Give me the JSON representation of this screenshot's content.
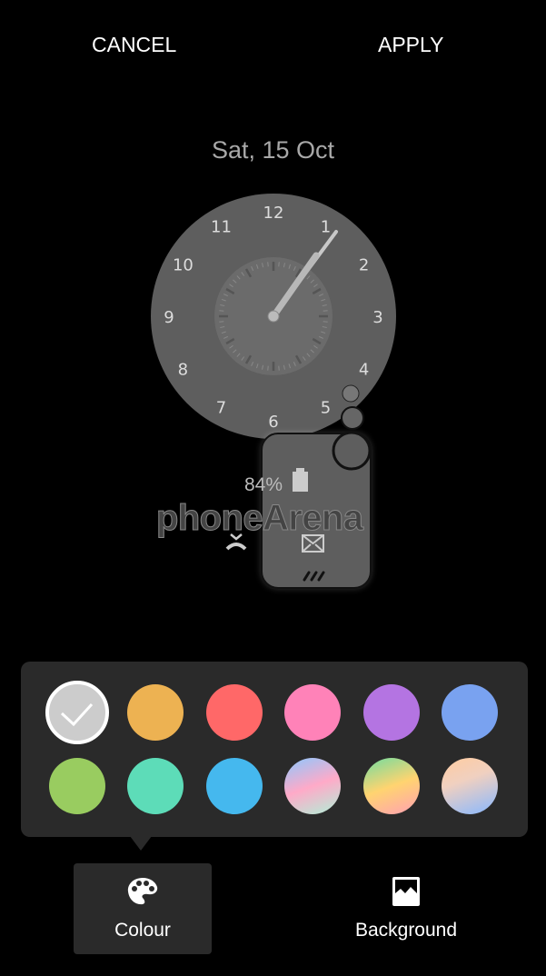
{
  "header": {
    "cancel_label": "CANCEL",
    "apply_label": "APPLY"
  },
  "preview": {
    "date": "Sat, 15 Oct",
    "clock_numbers": [
      "12",
      "1",
      "2",
      "3",
      "4",
      "5",
      "6",
      "7",
      "8",
      "9",
      "10",
      "11"
    ],
    "battery_percent": "84%",
    "watermark": "phoneArena"
  },
  "palette": {
    "swatches": [
      {
        "name": "grey",
        "color": "#cccccc",
        "selected": true
      },
      {
        "name": "orange",
        "color": "#edb252"
      },
      {
        "name": "red",
        "color": "#ff6868"
      },
      {
        "name": "pink",
        "color": "#ff82b8"
      },
      {
        "name": "purple",
        "color": "#b474e2"
      },
      {
        "name": "blue",
        "color": "#79a2f0"
      },
      {
        "name": "green",
        "color": "#99cc60"
      },
      {
        "name": "mint",
        "color": "#5ddcb8"
      },
      {
        "name": "sky",
        "color": "#45b8ee"
      },
      {
        "name": "gradient-blue-pink-mint",
        "color": "linear-gradient(160deg,#8cc8ff,#ffaac8 50%,#b0f0d8)"
      },
      {
        "name": "gradient-green-yellow-pink",
        "color": "linear-gradient(160deg,#70dca0,#ffd470 50%,#ffa0b4)"
      },
      {
        "name": "gradient-peach-blue",
        "color": "linear-gradient(160deg,#ffcca0,#f0d0c0 40%,#88b8ff)"
      }
    ]
  },
  "tabs": [
    {
      "label": "Colour",
      "icon": "palette-icon",
      "active": true
    },
    {
      "label": "Background",
      "icon": "image-icon",
      "active": false
    }
  ]
}
